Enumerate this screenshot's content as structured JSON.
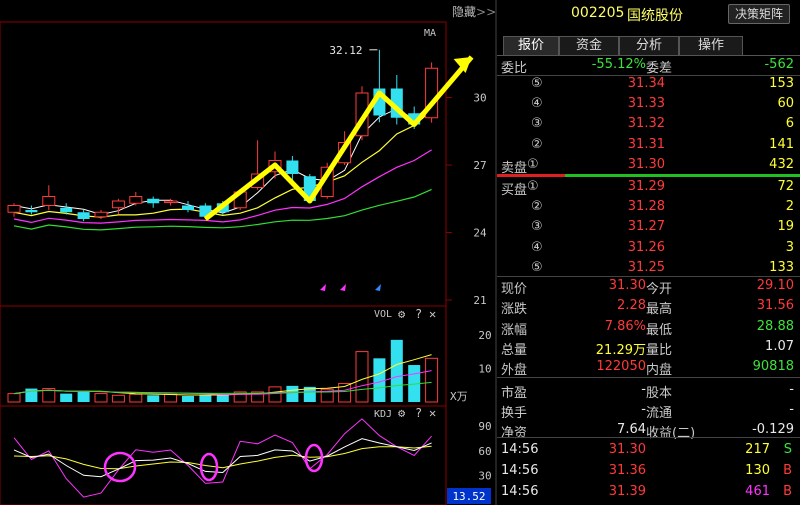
{
  "toolbar": {
    "hide_label": "隐藏",
    "hide_icon": "double-chevron-right-icon"
  },
  "stock": {
    "code": "002205",
    "name": "国统股份",
    "matrix_button": "决策矩阵"
  },
  "tabs": [
    "报价",
    "资金",
    "分析",
    "操作"
  ],
  "weibi": {
    "label1": "委比",
    "value1": "-55.12%",
    "label2": "委差",
    "value2": "-562"
  },
  "asks": [
    {
      "level": "⑤",
      "price": "31.34",
      "vol": "153"
    },
    {
      "level": "④",
      "price": "31.33",
      "vol": "60"
    },
    {
      "level": "③",
      "price": "31.32",
      "vol": "6"
    },
    {
      "level": "②",
      "price": "31.31",
      "vol": "141"
    },
    {
      "level": "①",
      "label": "卖盘",
      "price": "31.30",
      "vol": "432"
    }
  ],
  "bids": [
    {
      "level": "①",
      "label": "买盘",
      "price": "31.29",
      "vol": "72"
    },
    {
      "level": "②",
      "price": "31.28",
      "vol": "2"
    },
    {
      "level": "③",
      "price": "31.27",
      "vol": "19"
    },
    {
      "level": "④",
      "price": "31.26",
      "vol": "3"
    },
    {
      "level": "⑤",
      "price": "31.25",
      "vol": "133"
    }
  ],
  "stats": {
    "xianjia": {
      "l": "现价",
      "v": "31.30",
      "l2": "今开",
      "v2": "29.10"
    },
    "zhangdie": {
      "l": "涨跌",
      "v": "2.28",
      "l2": "最高",
      "v2": "31.56"
    },
    "zhangfu": {
      "l": "涨幅",
      "v": "7.86%",
      "l2": "最低",
      "v2": "28.88"
    },
    "zongliang": {
      "l": "总量",
      "v": "21.29万",
      "l2": "量比",
      "v2": "1.07"
    },
    "waipan": {
      "l": "外盘",
      "v": "122050",
      "l2": "内盘",
      "v2": "90818"
    },
    "shiying": {
      "l": "市盈",
      "v": "-",
      "l2": "股本",
      "v2": "-"
    },
    "huanshou": {
      "l": "换手",
      "v": "-",
      "l2": "流通",
      "v2": "-"
    },
    "jingzi": {
      "l": "净资",
      "v": "7.64",
      "l2": "收益(二)",
      "v2": "-0.129"
    }
  },
  "ticks": [
    {
      "time": "14:56",
      "price": "31.30",
      "vol": "217",
      "flag": "S"
    },
    {
      "time": "14:56",
      "price": "31.36",
      "vol": "130",
      "flag": "B"
    },
    {
      "time": "14:56",
      "price": "31.39",
      "vol": "461",
      "flag": "B"
    }
  ],
  "chart": {
    "ma_label": "MA",
    "peak_label": "32.12",
    "price_ticks": [
      "30",
      "27",
      "24",
      "21"
    ],
    "vol_label": "VOL",
    "vol_ticks": [
      "20",
      "10"
    ],
    "vol_unit": "X万",
    "kdj_label": "KDJ",
    "kdj_ticks": [
      "90",
      "60",
      "30"
    ],
    "crosshair_value": "13.52",
    "icons": [
      "gear-icon",
      "question-icon",
      "close-icon"
    ]
  },
  "chart_data": {
    "type": "candlestick",
    "price_ylim": [
      21,
      33
    ],
    "candles": [
      {
        "o": 24.9,
        "c": 25.2,
        "h": 25.3,
        "l": 24.7
      },
      {
        "o": 25.0,
        "c": 24.9,
        "h": 25.2,
        "l": 24.8
      },
      {
        "o": 25.2,
        "c": 25.6,
        "h": 26.1,
        "l": 25.0
      },
      {
        "o": 25.1,
        "c": 24.9,
        "h": 25.3,
        "l": 24.8
      },
      {
        "o": 24.9,
        "c": 24.6,
        "h": 25.0,
        "l": 24.5
      },
      {
        "o": 24.7,
        "c": 24.9,
        "h": 25.0,
        "l": 24.6
      },
      {
        "o": 25.1,
        "c": 25.4,
        "h": 25.5,
        "l": 24.8
      },
      {
        "o": 25.3,
        "c": 25.6,
        "h": 25.8,
        "l": 25.2
      },
      {
        "o": 25.5,
        "c": 25.3,
        "h": 25.6,
        "l": 25.1
      },
      {
        "o": 25.4,
        "c": 25.4,
        "h": 25.5,
        "l": 25.2
      },
      {
        "o": 25.2,
        "c": 25.0,
        "h": 25.4,
        "l": 24.9
      },
      {
        "o": 25.2,
        "c": 24.7,
        "h": 25.3,
        "l": 24.6
      },
      {
        "o": 25.3,
        "c": 24.9,
        "h": 25.4,
        "l": 24.8
      },
      {
        "o": 25.1,
        "c": 25.8,
        "h": 25.9,
        "l": 25.0
      },
      {
        "o": 26.0,
        "c": 26.6,
        "h": 28.1,
        "l": 25.9
      },
      {
        "o": 26.7,
        "c": 27.2,
        "h": 27.6,
        "l": 26.4
      },
      {
        "o": 27.2,
        "c": 26.6,
        "h": 27.4,
        "l": 26.3
      },
      {
        "o": 26.5,
        "c": 25.4,
        "h": 26.6,
        "l": 25.3
      },
      {
        "o": 25.6,
        "c": 26.9,
        "h": 27.1,
        "l": 25.5
      },
      {
        "o": 27.1,
        "c": 28.0,
        "h": 28.5,
        "l": 27.0
      },
      {
        "o": 28.3,
        "c": 30.2,
        "h": 30.5,
        "l": 28.1
      },
      {
        "o": 30.4,
        "c": 29.2,
        "h": 32.12,
        "l": 28.9
      },
      {
        "o": 30.4,
        "c": 29.1,
        "h": 31.0,
        "l": 28.8
      },
      {
        "o": 29.3,
        "c": 28.8,
        "h": 29.6,
        "l": 28.6
      },
      {
        "o": 29.1,
        "c": 31.3,
        "h": 31.56,
        "l": 28.88
      }
    ],
    "volumes": [
      2.5,
      4.0,
      4.0,
      2.5,
      3.0,
      2.5,
      2.0,
      2.3,
      2.0,
      2.3,
      1.8,
      2.0,
      2.3,
      3.0,
      3.0,
      4.5,
      4.8,
      4.5,
      3.8,
      5.5,
      15.0,
      13.0,
      18.5,
      11.0,
      13.0
    ],
    "vol_ylim": [
      0,
      25
    ],
    "kdj_ylim": [
      0,
      100
    ]
  }
}
